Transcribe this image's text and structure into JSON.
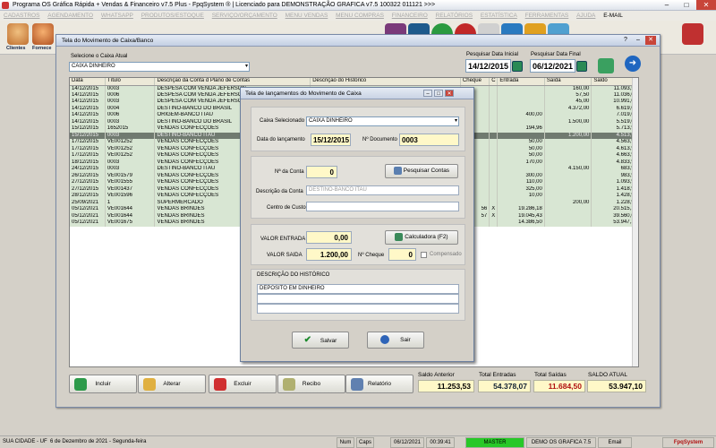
{
  "app": {
    "title": "Programa OS Gráfica Rápida + Vendas & Financeiro v7.5 Plus - FpqSystem ® | Licenciado para  DEMONSTRAÇÃO GRAFICA v7.5 100322 011121 >>>"
  },
  "menu": [
    "CADASTROS",
    "AGENDAMENTO",
    "WHATSAPP",
    "PRODUTOS/ESTOQUE",
    "SERVIÇO/ORÇAMENTO",
    "MENU VENDAS",
    "MENU COMPRAS",
    "FINANCEIRO",
    "RELATÓRIOS",
    "ESTATÍSTICA",
    "FERRAMENTAS",
    "AJUDA",
    "E-MAIL"
  ],
  "toolbar": {
    "clientes": "Clientes",
    "fornecedores": "Fornece"
  },
  "main": {
    "title": "Tela do Movimento de Caixa/Banco",
    "select_caixa_label": "Selecione o Caixa Atual",
    "select_caixa_value": "CAIXA DINHEIRO",
    "search_start_label": "Pesquisar Data Inicial",
    "search_start_value": "14/12/2015",
    "search_end_label": "Pesquisar Data Final",
    "search_end_value": "06/12/2021",
    "columns": [
      "Data",
      "Título",
      "Descrição da Conta d Plano de Contas",
      "Descrição do Histórico",
      "Cheque",
      "C",
      "Entrada",
      "Saída",
      "Saldo"
    ],
    "rows": [
      [
        "14/12/2015",
        "0003",
        "DESPESA COM VENDA JEFERSON",
        "",
        "",
        "",
        "",
        "160,00",
        "11.093,53"
      ],
      [
        "14/12/2015",
        "0006",
        "DESPESA COM VENDA JEFERSON",
        "",
        "",
        "",
        "",
        "57,50",
        "11.036,03"
      ],
      [
        "14/12/2015",
        "0003",
        "DESPESA COM VENDA JEFERSON",
        "",
        "",
        "",
        "",
        "45,00",
        "10.991,03"
      ],
      [
        "14/12/2015",
        "0004",
        "DESTINO-BANCO DO BRASIL",
        "",
        "",
        "",
        "",
        "4.372,00",
        "6.619,03"
      ],
      [
        "14/12/2015",
        "0006",
        "ORIGEM-BANCO ITAU",
        "",
        "",
        "",
        "400,00",
        "",
        "7.019,03"
      ],
      [
        "14/12/2015",
        "0003",
        "DESTINO-BANCO DO BRASIL",
        "",
        "",
        "",
        "",
        "1.500,00",
        "5.519,03"
      ],
      [
        "15/12/2015",
        "1652015",
        "VENDAS CONFECÇÕES",
        "",
        "",
        "",
        "194,96",
        "",
        "5.713,99"
      ],
      [
        "15/12/2015",
        "0003",
        "DESTINO-BANCO ITAU",
        "",
        "",
        "",
        "",
        "1.200,00",
        "4.513,99"
      ],
      [
        "17/12/2015",
        "VE001252",
        "VENDAS CONFECÇÕES",
        "",
        "",
        "",
        "50,00",
        "",
        "4.563,99"
      ],
      [
        "17/12/2015",
        "VE001252",
        "VENDAS CONFECÇÕES",
        "",
        "",
        "",
        "50,00",
        "",
        "4.613,99"
      ],
      [
        "17/12/2015",
        "VE001252",
        "VENDAS CONFECÇÕES",
        "",
        "",
        "",
        "50,00",
        "",
        "4.663,99"
      ],
      [
        "18/12/2015",
        "0003",
        "VENDAS CONFECÇÕES",
        "",
        "",
        "",
        "170,00",
        "",
        "4.833,99"
      ],
      [
        "24/12/2015",
        "0003",
        "DESTINO-BANCO ITAU",
        "",
        "",
        "",
        "",
        "4.150,00",
        "683,99"
      ],
      [
        "26/12/2015",
        "VE001579",
        "VENDAS CONFECÇÕES",
        "",
        "",
        "",
        "300,00",
        "",
        "983,99"
      ],
      [
        "27/12/2015",
        "VE001555",
        "VENDAS CONFECÇÕES",
        "",
        "",
        "",
        "110,00",
        "",
        "1.093,99"
      ],
      [
        "27/12/2015",
        "VE001437",
        "VENDAS CONFECÇÕES",
        "",
        "",
        "",
        "325,00",
        "",
        "1.418,99"
      ],
      [
        "28/12/2015",
        "VE001596",
        "VENDAS CONFECÇÕES",
        "",
        "",
        "",
        "10,00",
        "",
        "1.428,99"
      ],
      [
        "25/09/2021",
        "1",
        "SUPERMERCADO",
        "",
        "",
        "",
        "",
        "200,00",
        "1.228,99"
      ],
      [
        "05/12/2021",
        "VE001644",
        "VENDAS BRINDES",
        "",
        "56",
        "X",
        "19.286,18",
        "",
        "20.515,17"
      ],
      [
        "05/12/2021",
        "VE001644",
        "VENDAS BRINDES",
        "",
        "57",
        "X",
        "19.045,43",
        "",
        "39.560,60"
      ],
      [
        "05/12/2021",
        "VE001675",
        "VENDAS BRINDES",
        "",
        "",
        "",
        "14.386,50",
        "",
        "53.947,10"
      ]
    ],
    "buttons": {
      "incluir": "Incluir",
      "alterar": "Alterar",
      "excluir": "Excluir",
      "recibo": "Recibo",
      "relatorio": "Relatório"
    },
    "totals": {
      "saldo_anterior_label": "Saldo Anterior",
      "saldo_anterior": "11.253,53",
      "total_entradas_label": "Total Entradas",
      "total_entradas": "54.378,07",
      "total_saidas_label": "Total Saídas",
      "total_saidas": "11.684,50",
      "saldo_atual_label": "SALDO ATUAL",
      "saldo_atual": "53.947,10"
    }
  },
  "dialog": {
    "title": "Tela de lançamentos do Movimento de Caixa",
    "caixa_label": "Caixa Selecionado",
    "caixa_value": "CAIXA DINHEIRO",
    "data_label": "Data do lançamento",
    "data_value": "15/12/2015",
    "documento_label": "Nº Documento",
    "documento_value": "0003",
    "conta_num_label": "Nª da Conta",
    "conta_num_value": "0",
    "pesquisar_contas": "Pesquisar Contas",
    "desc_conta_label": "Descrição da Conta",
    "desc_conta_value": "DESTINO-BANCO ITAU",
    "centro_custo_label": "Centro de Custo",
    "valor_entrada_label": "VALOR ENTRADA",
    "valor_entrada": "0,00",
    "calculadora": "Calculadora  (F2)",
    "valor_saida_label": "VALOR SAIDA",
    "valor_saida": "1.200,00",
    "cheque_label": "Nº Cheque",
    "cheque_value": "0",
    "compensado_label": "Compensado",
    "historico_label": "DESCRIÇÃO DO HISTÓRICO",
    "historico_line1": "DEPOSITO EM DINHEIRO",
    "salvar": "Salvar",
    "sair": "Sair"
  },
  "status": {
    "city": "SUA CIDADE - UF",
    "date_text": "6 de Dezembro de 2021 - Segunda-feira",
    "num": "Num",
    "caps": "Caps",
    "date": "06/12/2021",
    "time": "00:39:41",
    "master": "MASTER",
    "company": "DEMO OS GRAFICA 7.5",
    "email": "Email",
    "brand": "FpqSystem"
  }
}
